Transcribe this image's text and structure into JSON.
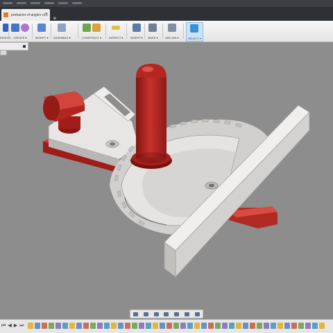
{
  "window": {
    "tab_title": "protractor of angles v10",
    "tab_close": "×",
    "new_tab": "+"
  },
  "toolbar": {
    "groups": [
      {
        "label": "DESIGN",
        "icon": "workspace-icon"
      },
      {
        "label": "CREATE ▾",
        "icon": "create-icon"
      },
      {
        "label": "MODIFY ▾",
        "icon": "modify-icon"
      },
      {
        "label": "ASSEMBLE ▾",
        "icon": "assemble-icon"
      },
      {
        "label": "CONSTRUCT ▾",
        "icon": "construct-icon"
      },
      {
        "label": "INSPECT ▾",
        "icon": "inspect-icon"
      },
      {
        "label": "INSERT ▾",
        "icon": "insert-icon"
      },
      {
        "label": "MAKE ▾",
        "icon": "make-icon"
      },
      {
        "label": "ADD-INS ▾",
        "icon": "add-ins-icon"
      },
      {
        "label": "SELECT ▾",
        "icon": "select-icon"
      }
    ]
  },
  "timeline": {
    "controls": [
      "⏮",
      "◀",
      "▶",
      "⏭"
    ]
  },
  "colors": {
    "model_body": "#e8e6e4",
    "handle": "#b3201b",
    "background": "#8d8d8d",
    "toolbar": "#efefef",
    "accent": "#3a8fd8"
  }
}
